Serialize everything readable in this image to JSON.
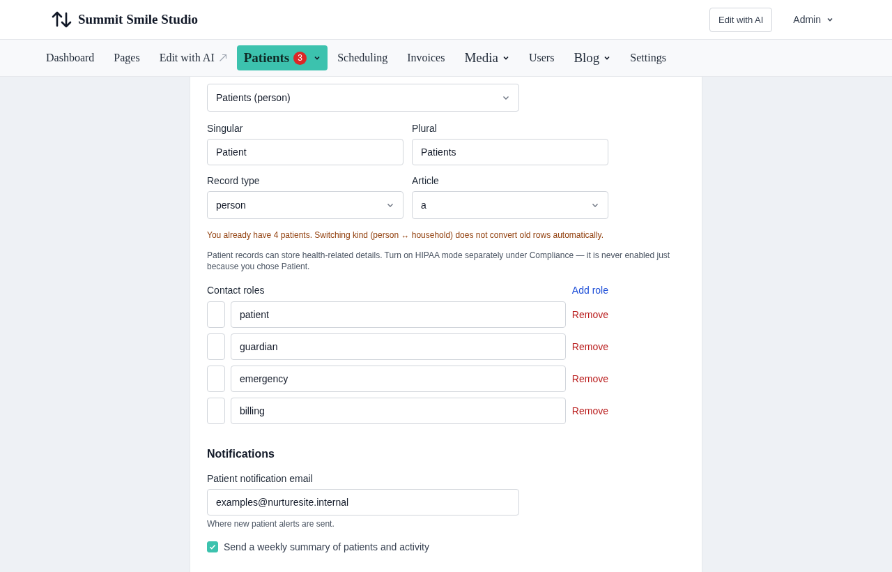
{
  "brand": {
    "name": "Summit Smile Studio"
  },
  "header_actions": {
    "edit_button": "Edit with AI",
    "user_menu": "Admin"
  },
  "nav": [
    {
      "label": "Dashboard",
      "kind": "link",
      "selected": false
    },
    {
      "label": "Pages",
      "kind": "link",
      "selected": false
    },
    {
      "label": "Edit with AI",
      "kind": "external",
      "selected": false
    },
    {
      "label": "Patients",
      "kind": "dropdown",
      "selected": true,
      "badge": "3"
    },
    {
      "label": "Scheduling",
      "kind": "link",
      "selected": false
    },
    {
      "label": "Invoices",
      "kind": "link",
      "selected": false
    },
    {
      "label": "Media",
      "kind": "dropdown",
      "selected": false
    },
    {
      "label": "Users",
      "kind": "link",
      "selected": false
    },
    {
      "label": "Blog",
      "kind": "dropdown",
      "selected": false
    },
    {
      "label": "Settings",
      "kind": "link",
      "selected": false
    }
  ],
  "catalog": {
    "value": "Patients (person)"
  },
  "singular": {
    "label": "Singular",
    "value": "Patient"
  },
  "plural": {
    "label": "Plural",
    "value": "Patients"
  },
  "record_type": {
    "label": "Record type",
    "value": "person"
  },
  "article": {
    "label": "Article",
    "value": "a"
  },
  "warning": "You already have 4 patients. Switching kind (person ↔ household) does not convert old rows automatically.",
  "note": "Patient records can store health-related details. Turn on HIPAA mode separately under Compliance — it is never enabled just because you chose Patient.",
  "contact_roles": {
    "label": "Contact roles",
    "add_link": "Add role",
    "roles": [
      {
        "value": "patient",
        "remove": "Remove"
      },
      {
        "value": "guardian",
        "remove": "Remove"
      },
      {
        "value": "emergency",
        "remove": "Remove"
      },
      {
        "value": "billing",
        "remove": "Remove"
      }
    ]
  },
  "notifications": {
    "heading": "Notifications",
    "email_label": "Patient notification email",
    "email": "examples@nurturesite.internal",
    "email_hint": "Where new patient alerts are sent.",
    "weekly_summary": {
      "label": "Send a weekly summary of patients and activity",
      "checked": true
    }
  }
}
